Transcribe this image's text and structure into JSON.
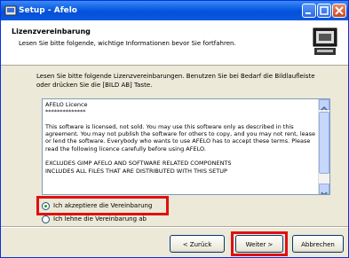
{
  "window": {
    "title": "Setup - Afelo"
  },
  "header": {
    "title": "Lizenzvereinbarung",
    "subtitle": "Lesen Sie bitte folgende, wichtige Informationen bevor Sie fortfahren."
  },
  "intro": {
    "text": "Lesen Sie bitte folgende Lizenzvereinbarungen. Benutzen Sie bei Bedarf die Bildlaufleiste oder drücken Sie die [BILD AB] Taste."
  },
  "license": {
    "text": "AFELO Licence\n**************\n\nThis software is licensed, not sold. You may use this software only as described in this agreement. You may not publish the software for others to copy, and you may not rent, lease or lend the software. Everybody who wants to use AFELO has to accept these terms. Please read the following licence carefully before using AFELO.\n\nEXCLUDES GIMP AFELO AND SOFTWARE RELATED COMPONENTS\nINCLUDES ALL FILES THAT ARE DISTRIBUTED WITH THIS SETUP"
  },
  "options": {
    "accept": "Ich akzeptiere die Vereinbarung",
    "decline": "Ich lehne die Vereinbarung ab"
  },
  "buttons": {
    "back": "< Zurück",
    "next": "Weiter >",
    "cancel": "Abbrechen"
  },
  "colors": {
    "titlebar": "#0a5ae0",
    "highlight": "#e01010",
    "radio_selected": "#21a121"
  }
}
